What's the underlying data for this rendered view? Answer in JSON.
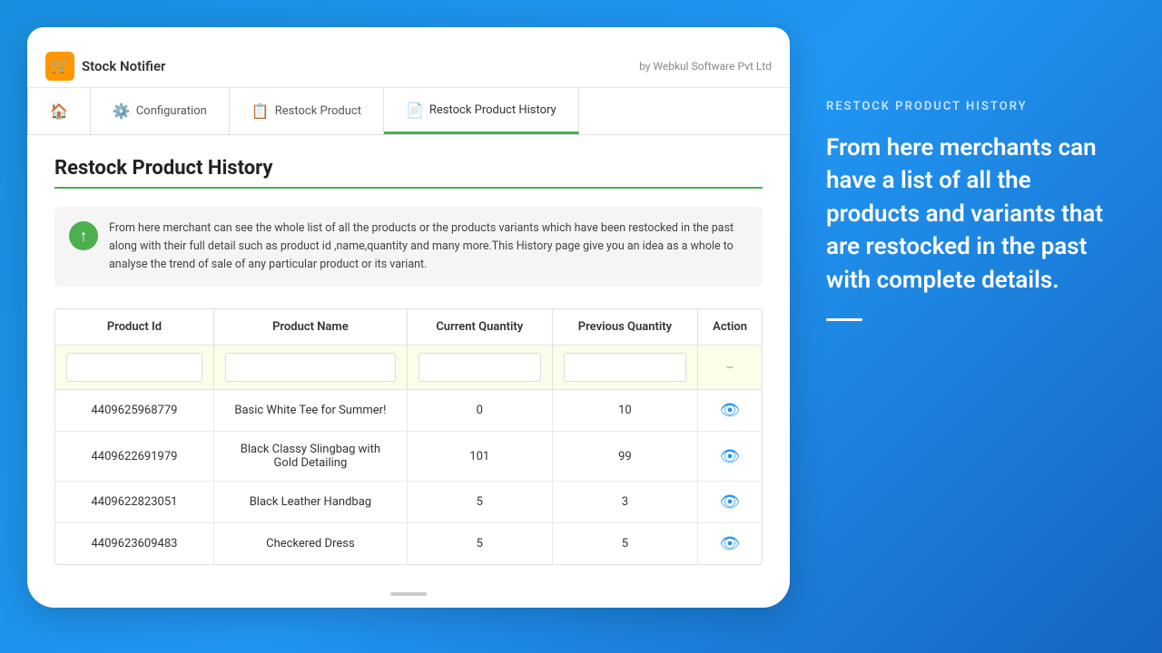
{
  "app": {
    "icon": "🛒",
    "title": "Stock Notifier",
    "by_text": "by Webkul Software Pvt Ltd"
  },
  "nav": {
    "items": [
      {
        "id": "home",
        "label": "",
        "icon": "🏠",
        "active": false
      },
      {
        "id": "configuration",
        "label": "Configuration",
        "icon": "⚙️",
        "active": false
      },
      {
        "id": "restock-product",
        "label": "Restock Product",
        "icon": "📋",
        "active": false
      },
      {
        "id": "restock-product-history",
        "label": "Restock Product History",
        "icon": "📄",
        "active": true
      }
    ]
  },
  "page": {
    "title": "Restock Product History",
    "info_text": "From here merchant can see the whole list of all the products or the products variants which have been restocked in the past along with their full detail such as product id ,name,quantity and many more.This History page give you an idea as a whole to analyse the trend of sale of any particular product or its variant."
  },
  "table": {
    "columns": [
      "Product Id",
      "Product Name",
      "Current Quantity",
      "Previous Quantity",
      "Action"
    ],
    "filter_placeholder": "--",
    "rows": [
      {
        "id": "4409625968779",
        "name": "Basic White Tee for Summer!",
        "current_qty": "0",
        "previous_qty": "10"
      },
      {
        "id": "4409622691979",
        "name": "Black Classy Slingbag with Gold Detailing",
        "current_qty": "101",
        "previous_qty": "99"
      },
      {
        "id": "4409622823051",
        "name": "Black Leather Handbag",
        "current_qty": "5",
        "previous_qty": "3"
      },
      {
        "id": "4409623609483",
        "name": "Checkered Dress",
        "current_qty": "5",
        "previous_qty": "5"
      }
    ]
  },
  "right_panel": {
    "label": "RESTOCK PRODUCT HISTORY",
    "description": "From here merchants can have a list of all the products and variants that are restocked in the past with complete details."
  }
}
